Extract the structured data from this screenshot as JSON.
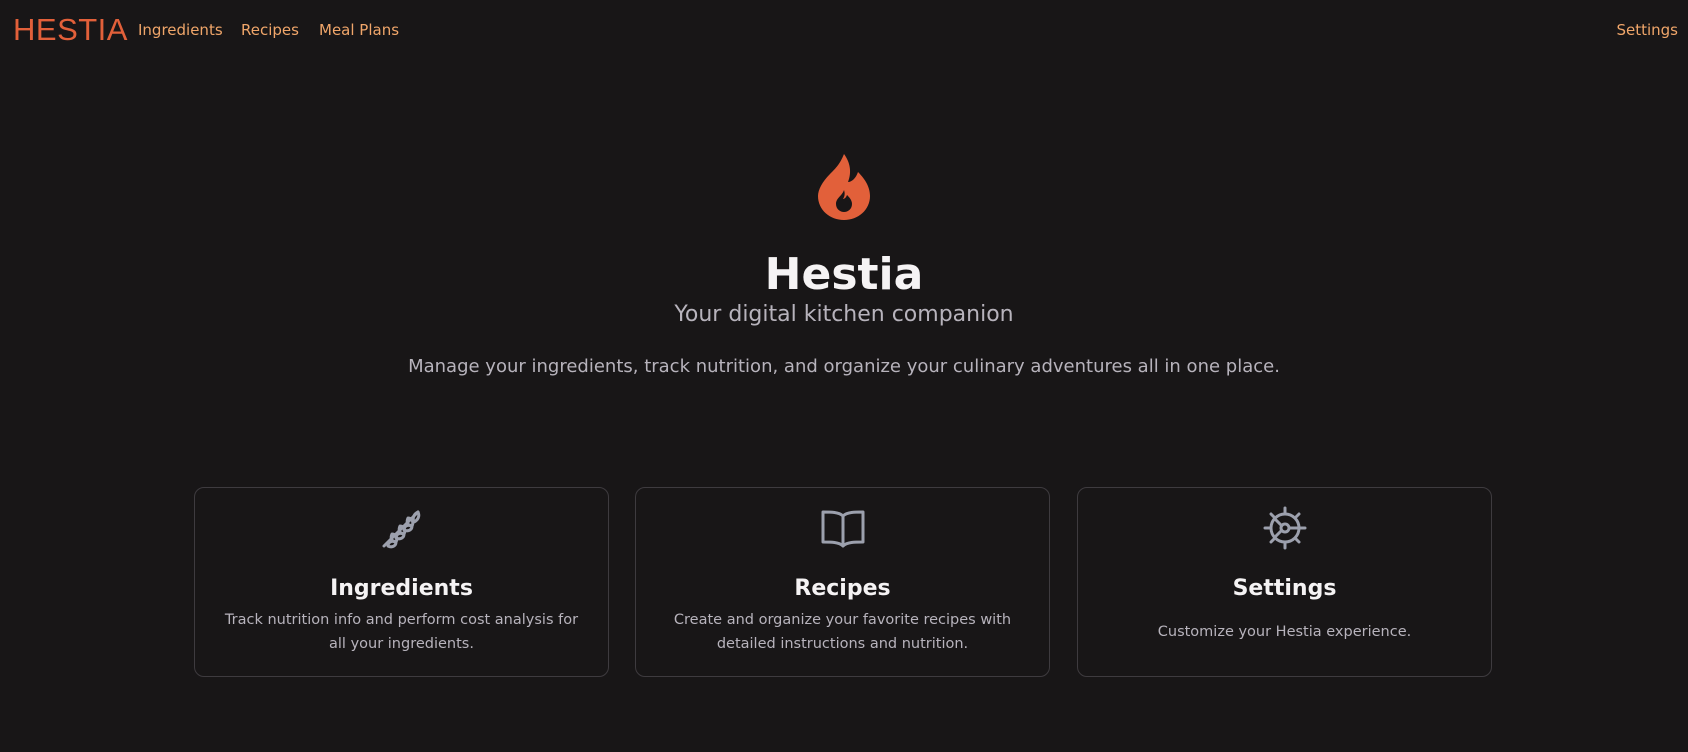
{
  "navbar": {
    "brand": "HESTIA",
    "links": {
      "ingredients": "Ingredients",
      "recipes": "Recipes",
      "meal_plans": "Meal Plans",
      "settings": "Settings"
    }
  },
  "hero": {
    "logo_icon": "flame-icon",
    "title": "Hestia",
    "subtitle": "Your digital kitchen companion",
    "description": "Manage your ingredients, track nutrition, and organize your culinary adventures all in one place."
  },
  "cards": [
    {
      "icon": "wheat-icon",
      "title": "Ingredients",
      "description": "Track nutrition info and perform cost analysis for all your ingredients."
    },
    {
      "icon": "book-open-icon",
      "title": "Recipes",
      "description": "Create and organize your favorite recipes with detailed instructions and nutrition."
    },
    {
      "icon": "gear-icon",
      "title": "Settings",
      "description": "Customize your Hestia experience."
    }
  ],
  "colors": {
    "background": "#181617",
    "brand": "#e2603a",
    "nav_link": "#f0a66a",
    "heading": "#f5f3f4",
    "muted_text": "#b7b3bc",
    "card_border": "#3e3b3f",
    "icon_gray": "#9ca0ad"
  }
}
